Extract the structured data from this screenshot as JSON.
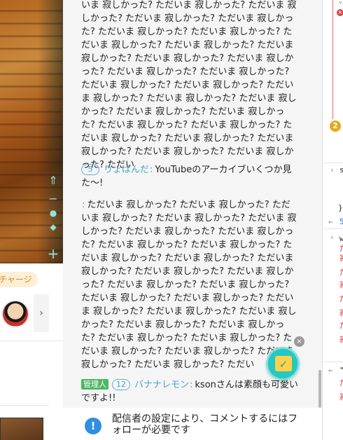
{
  "left_panel": {
    "charge_label": "チャージ",
    "avatar_next": "›",
    "player_icons": [
      "⇑",
      "−",
      "●",
      "◆",
      "+"
    ]
  },
  "chat": {
    "messages": [
      {
        "level": "",
        "username": "",
        "text": "いま 寂しかった? ただいま 寂しかった? ただいま 寂しかった? ただいま 寂しかった? ただいま 寂しかった? ただいま 寂しかった? ただいま 寂しかった? ただいま 寂しかった? ただいま 寂しかった? ただいま 寂しかった? ただいま 寂しかった? ただいま 寂しかった? ただいま 寂しかった? ただいま 寂しかった? ただいま 寂しかった? ただいま 寂しかった? ただいま 寂しかった? ただいま 寂しかった? ただいま 寂しかった? ただいま 寂しかった? ただいま 寂しかった? ただいま 寂しかった? ただいま 寂しかった? ただいま 寂しかった? ただいま 寂しかった? ただいま 寂しかった? ただいま 寂しかった? ただいま 寂しかった? ただい"
      },
      {
        "level": "5",
        "username": "りょぱんだ",
        "text": "YouTubeのアーカイブいくつか見た〜!"
      },
      {
        "level": "",
        "username": "",
        "text": "ただいま 寂しかった? ただいま 寂しかった? ただいま 寂しかった? ただいま 寂しかった? ただいま 寂しかった? ただいま 寂しかった? ただいま 寂しかった? ただいま 寂しかった? ただいま 寂しかった? ただいま 寂しかった? ただいま 寂しかった? ただいま 寂しかった? ただいま 寂しかった? ただいま 寂しかった? ただいま 寂しかった? ただいま 寂しかった? ただいま 寂しかった? ただいま 寂しかった? ただいま 寂しかった? ただいま 寂しかった? ただいま 寂しかった? ただいま 寂しかった? ただいま 寂しかった? ただいま 寂しかった? ただいま 寂しかった? ただいま 寂しかった? ただいま 寂しかった? ただいま 寂しかった? ただいま 寂しかった? ただい"
      },
      {
        "admin_badge": "管理人",
        "level": "12",
        "username": "バナナレモン",
        "text": "ksonさんは素顔も可愛いですよ!!"
      }
    ],
    "separator": ":",
    "close_glyph": "×",
    "calendar_glyph": "✓"
  },
  "notice": {
    "icon_glyph": "!",
    "text": "配信者の設定により、コメントするにはフォローが必要です"
  },
  "devtools": {
    "err_glyph": "×",
    "warn_count": "2",
    "lines": [
      "s",
      "}",
      "5",
      "w",
      "\""
    ],
    "red_chars": [
      "だ",
      "寂",
      "だ",
      "寂",
      "だ",
      "寂",
      "だ",
      "寂",
      "だ",
      "寂"
    ]
  },
  "colors": {
    "accent_blue": "#4aa6c8",
    "admin_green": "#4cb863",
    "notice_blue": "#2f8fe0",
    "charge_orange": "#e08a1c"
  }
}
